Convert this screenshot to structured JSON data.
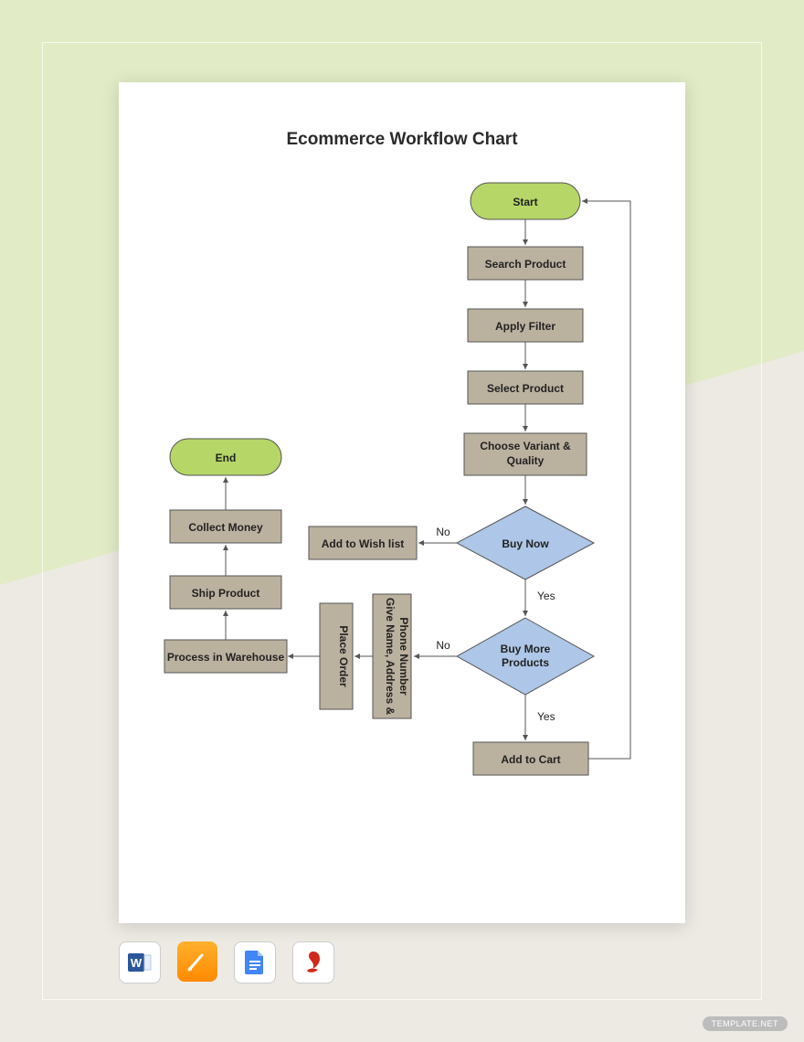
{
  "watermark": "TEMPLATE.NET",
  "title": "Ecommerce Workflow Chart",
  "nodes": {
    "start": "Start",
    "search": "Search Product",
    "filter": "Apply Filter",
    "select": "Select Product",
    "variant_l1": "Choose Variant &",
    "variant_l2": "Quality",
    "buynow": "Buy Now",
    "wishlist": "Add to Wish list",
    "buymore_l1": "Buy More",
    "buymore_l2": "Products",
    "give_l1": "Give Name, Address &",
    "give_l2": "Phone Number",
    "place": "Place Order",
    "addcart": "Add to Cart",
    "warehouse": "Process in Warehouse",
    "ship": "Ship Product",
    "collect": "Collect Money",
    "end": "End"
  },
  "labels": {
    "yes": "Yes",
    "no": "No"
  },
  "icons": [
    "word-icon",
    "pages-icon",
    "gdocs-icon",
    "pdf-icon"
  ],
  "colors": {
    "term": "#b6d667",
    "box": "#bbb19f",
    "dec": "#aec6e7",
    "stroke": "#555"
  }
}
